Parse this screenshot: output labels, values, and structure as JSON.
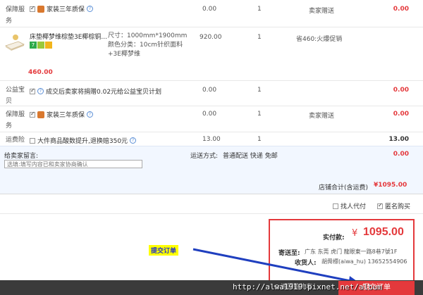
{
  "rows": [
    {
      "label": "保障服务",
      "service": "家装三年质保",
      "price": "0.00",
      "qty": "1",
      "method": "卖家赠送",
      "subtotal": "0.00"
    },
    {
      "title_line1": "床垫椰梦维棕垫3E椰棕铜...",
      "size": "尺寸：1000mm*1900mm",
      "color_line1": "颜色分类：10cm针织面料",
      "color_line2": "+3E椰梦维",
      "price": "920.00",
      "qty": "1",
      "promo": "省460:火爆促销",
      "discount_price": "460.00"
    },
    {
      "label": "公益宝贝",
      "service": "成交后卖家将捐赠0.02元给公益宝贝计划",
      "price": "0.00",
      "qty": "1",
      "subtotal": "0.00"
    },
    {
      "label": "保障服务",
      "service": "家装三年质保",
      "price": "0.00",
      "qty": "1",
      "method": "卖家赠送",
      "subtotal": "0.00"
    },
    {
      "label": "运费险",
      "service": "大件商品酸数提升,退换赔350元",
      "price": "13.00",
      "qty": "1",
      "subtotal": "13.00"
    }
  ],
  "message": {
    "label": "给卖家留言:",
    "placeholder": "选填:填写内容已和卖家协商确认"
  },
  "shipping": {
    "label": "运送方式:",
    "value": "普通配送 快递 免邮",
    "amount": "0.00"
  },
  "store_total": {
    "label": "店铺合计(含运费)",
    "value": "¥1095.00"
  },
  "options": {
    "pay_for_others": "找人代付",
    "anonymous": "匿名购买"
  },
  "summary": {
    "actual_label": "实付款:",
    "currency": "¥",
    "actual_amount": "1095.00",
    "ship_to_label": "寄送至:",
    "ship_to": "广东 东莞 虎门 龍眼東一路8巷7號1F",
    "receiver_label": "收货人:",
    "receiver": "胡舜標(aiwa_hu) 13652554906"
  },
  "annotation": {
    "label": "提交订单"
  },
  "footer": {
    "back_link": "返回购物车",
    "submit": "提交订单"
  },
  "watermark": "http://alwa1919.pixnet.net/album",
  "colors": {
    "accent": "#e4393c",
    "submit_bg": "#f40",
    "annotation_bg": "#ffff00",
    "arrow": "#1f3fbf"
  }
}
